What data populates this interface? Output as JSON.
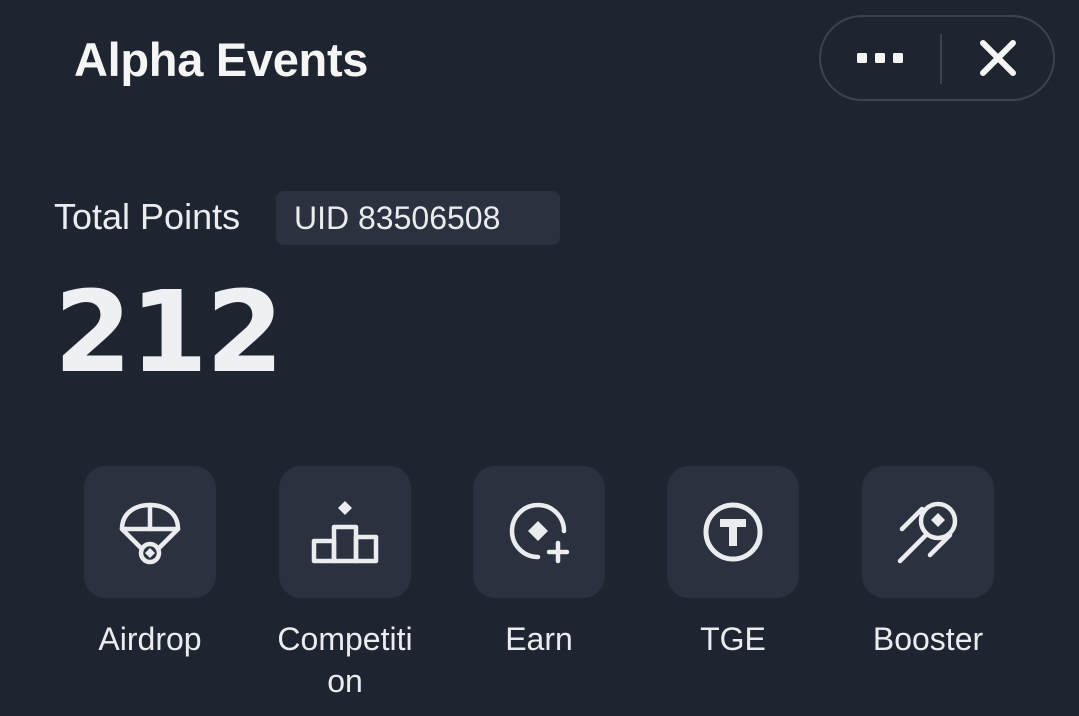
{
  "header": {
    "title": "Alpha Events"
  },
  "controls": {
    "more_icon": "more-dots-icon",
    "close_icon": "close-icon"
  },
  "summary": {
    "total_label": "Total Points",
    "uid": "UID 83506508",
    "points": "212"
  },
  "actions": [
    {
      "label": "Airdrop",
      "icon": "parachute-icon"
    },
    {
      "label": "Competition",
      "icon": "podium-icon"
    },
    {
      "label": "Earn",
      "icon": "earn-plus-icon"
    },
    {
      "label": "TGE",
      "icon": "tge-token-icon"
    },
    {
      "label": "Booster",
      "icon": "rocket-booster-icon"
    }
  ],
  "colors": {
    "background": "#1e2430",
    "tile": "#2b313e",
    "text": "#eaecef",
    "border": "#3b4250"
  }
}
